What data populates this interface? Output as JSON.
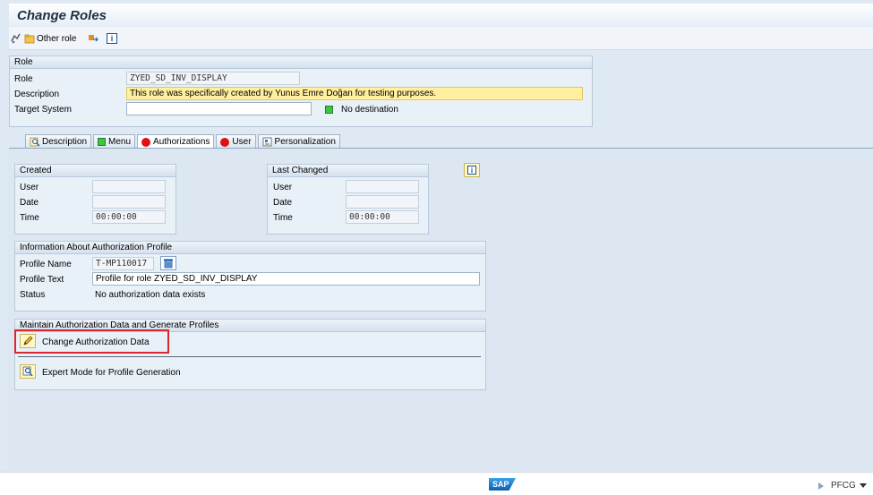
{
  "window": {
    "title": "Change Roles"
  },
  "toolbar": {
    "other_role": "Other role"
  },
  "role": {
    "group_title": "Role",
    "role_label": "Role",
    "role_value": "ZYED_SD_INV_DISPLAY",
    "description_label": "Description",
    "description_value": "This role was specifically created by Yunus Emre Doğan for testing purposes.",
    "target_label": "Target System",
    "target_value": "",
    "destination_status": "No destination"
  },
  "tabs": [
    {
      "label": "Description"
    },
    {
      "label": "Menu"
    },
    {
      "label": "Authorizations"
    },
    {
      "label": "User"
    },
    {
      "label": "Personalization"
    }
  ],
  "created": {
    "group_title": "Created",
    "user_label": "User",
    "user_value": "",
    "date_label": "Date",
    "date_value": "",
    "time_label": "Time",
    "time_value": "00:00:00"
  },
  "last_changed": {
    "group_title": "Last Changed",
    "user_label": "User",
    "user_value": "",
    "date_label": "Date",
    "date_value": "",
    "time_label": "Time",
    "time_value": "00:00:00"
  },
  "profile": {
    "group_title": "Information About Authorization Profile",
    "name_label": "Profile Name",
    "name_value": "T-MP110017",
    "text_label": "Profile Text",
    "text_value": "Profile for role ZYED_SD_INV_DISPLAY",
    "status_label": "Status",
    "status_value": "No authorization data exists"
  },
  "maintain": {
    "group_title": "Maintain Authorization Data and Generate Profiles",
    "change_auth_label": "Change Authorization Data",
    "expert_mode_label": "Expert Mode for Profile Generation"
  },
  "statusbar": {
    "logo": "SAP",
    "transaction": "PFCG"
  },
  "colors": {
    "accent_red": "#d9262f",
    "status_green": "#3cc83c",
    "status_red": "#e01010",
    "highlight_yellow": "#ffef9f"
  }
}
